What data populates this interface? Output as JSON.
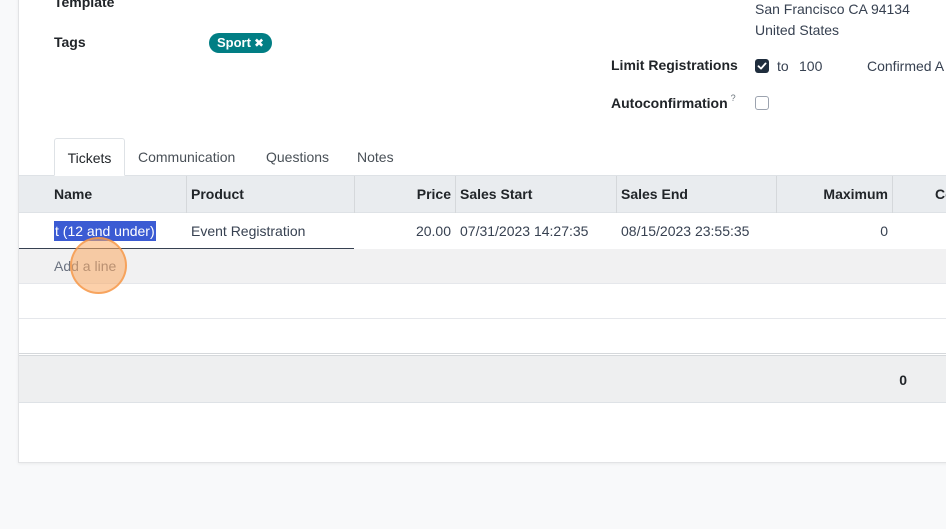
{
  "form": {
    "template_label": "Template",
    "tags_label": "Tags",
    "tags": [
      {
        "label": "Sport",
        "remove_glyph": "✖",
        "color": "#017e84"
      }
    ],
    "address_line1": "San Francisco CA 94134",
    "address_line2": "United States",
    "limit_registrations_label": "Limit Registrations",
    "limit_registrations_checked": true,
    "limit_to_text": "to",
    "limit_value": "100",
    "confirmed_text": "Confirmed A",
    "autoconfirmation_label": "Autoconfirmation",
    "autoconfirmation_help": "?",
    "autoconfirmation_checked": false
  },
  "tabs": [
    {
      "label": "Tickets",
      "active": true
    },
    {
      "label": "Communication",
      "active": false
    },
    {
      "label": "Questions",
      "active": false
    },
    {
      "label": "Notes",
      "active": false
    }
  ],
  "table": {
    "headers": [
      "Name",
      "Product",
      "Price",
      "Sales Start",
      "Sales End",
      "Maximum",
      "Co"
    ],
    "rows": [
      {
        "name": "t (12 and under)",
        "product": "Event Registration",
        "price": "20.00",
        "sales_start": "07/31/2023 14:27:35",
        "sales_end": "08/15/2023 23:55:35",
        "maximum": "0"
      }
    ],
    "add_line_label": "Add a line",
    "total_maximum": "0"
  },
  "colors": {
    "tag": "#017e84",
    "selection": "#3b5bd3",
    "header_bg": "#e9ecef",
    "cursor_highlight": "#f5a05a"
  }
}
